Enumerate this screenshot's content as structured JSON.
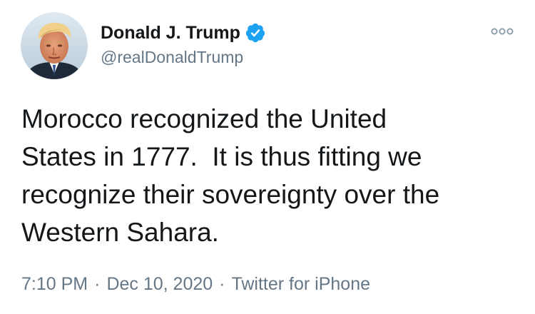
{
  "author": {
    "display_name": "Donald J. Trump",
    "handle": "@realDonaldTrump",
    "verified": true
  },
  "tweet": {
    "text": "Morocco recognized the United\nStates in 1777.  It is thus fitting we\nrecognize their sovereignty over the\nWestern Sahara."
  },
  "meta": {
    "time": "7:10 PM",
    "date": "Dec 10, 2020",
    "source": "Twitter for iPhone",
    "separator": "·"
  },
  "icons": {
    "verified": "verified-badge-icon",
    "more": "more-options-icon"
  },
  "colors": {
    "primary_text": "#14171a",
    "secondary_text": "#657786",
    "verified_blue": "#1da1f2"
  }
}
